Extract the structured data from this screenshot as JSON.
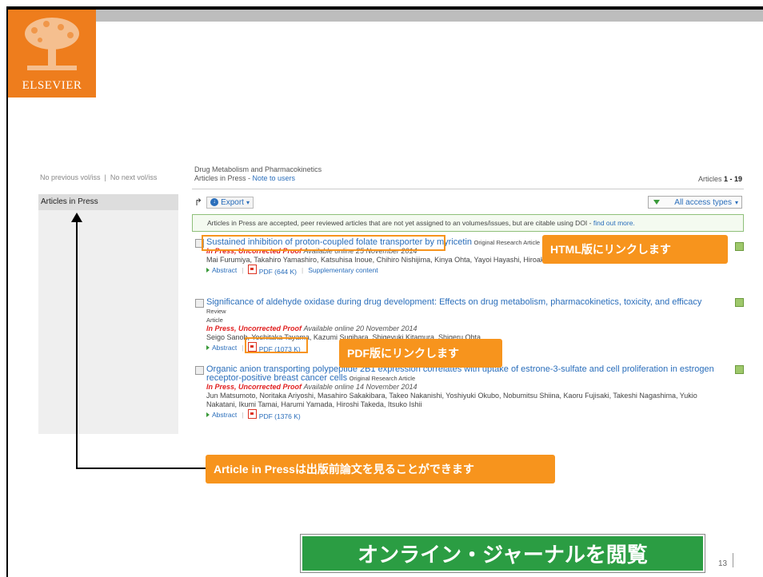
{
  "logo": {
    "text": "ELSEVIER"
  },
  "nav": {
    "prev": "No previous vol/iss",
    "next": "No next vol/iss",
    "sep": "|"
  },
  "sidebar": {
    "item": "Articles in Press"
  },
  "journal": {
    "name": "Drug Metabolism and Pharmacokinetics",
    "section": "Articles in Press - ",
    "note_link": "Note to users"
  },
  "count": {
    "prefix": "Articles ",
    "range": "1 - 19"
  },
  "toolbar": {
    "export": "Export",
    "access": "All access types"
  },
  "notice": {
    "text": "Articles in Press are accepted, peer reviewed articles that are not yet assigned to an volumes/issues, but are citable using DOI - ",
    "link": "find out more."
  },
  "articles": [
    {
      "title": "Sustained inhibition of proton-coupled folate transporter by myricetin",
      "type": "Original Research Article",
      "status": "In Press, Uncorrected Proof",
      "avail": "Available online 25 November 2014",
      "authors": "Mai Furumiya, Takahiro Yamashiro, Katsuhisa Inoue, Chihiro Nishijima, Kinya Ohta, Yayoi Hayashi, Hiroaki Yuasa",
      "abstract": "Abstract",
      "pdf": "PDF (644 K)",
      "supp": "Supplementary content"
    },
    {
      "title": "Significance of aldehyde oxidase during drug development: Effects on drug metabolism, pharmacokinetics, toxicity, and efficacy",
      "type_a": "Review",
      "type_b": "Article",
      "status": "In Press, Uncorrected Proof",
      "avail": "Available online 20 November 2014",
      "authors": "Seigo Sanoh, Yoshitaka Tayama, Kazumi Sugihara, Shigeyuki Kitamura, Shigeru Ohta",
      "abstract": "Abstract",
      "pdf": "PDF (1073 K)"
    },
    {
      "title_a": "Organic anion transporting polypeptide 2B1 expression correlates with uptake of estrone-3-sulfate and cell proliferation in estrogen",
      "title_b": "receptor-positive breast cancer cells",
      "type": "Original Research Article",
      "status": "In Press, Uncorrected Proof",
      "avail": "Available online 14 November 2014",
      "authors_a": "Jun Matsumoto, Noritaka Ariyoshi, Masahiro Sakakibara, Takeo Nakanishi, Yoshiyuki Okubo, Nobumitsu Shiina, Kaoru Fujisaki, Takeshi Nagashima, Yukio",
      "authors_b": "Nakatani, Ikumi Tamai, Harumi Yamada, Hiroshi Takeda, Itsuko Ishii",
      "abstract": "Abstract",
      "pdf": "PDF (1376 K)"
    }
  ],
  "callouts": {
    "html": "HTML版にリンクします",
    "pdf": "PDF版にリンクします",
    "aip": "Article in Pressは出版前論文を見ることができます"
  },
  "slide_title": "オンライン・ジャーナルを閲覧",
  "page_number": "13",
  "colors": {
    "accent": "#f7941d",
    "title_bg": "#2b9d43",
    "link": "#2a6ebb",
    "logo_bg": "#ee7d1d"
  }
}
